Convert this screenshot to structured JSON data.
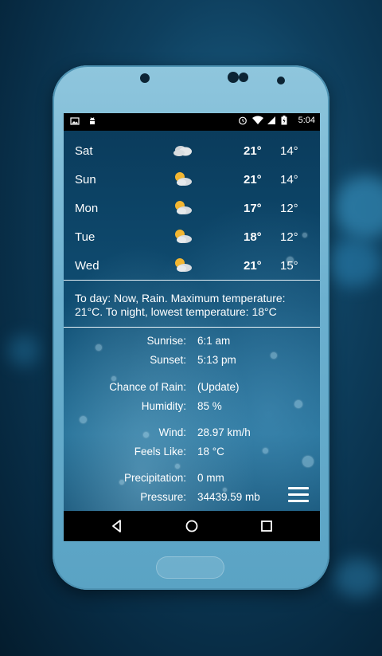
{
  "status_bar": {
    "left_icons": [
      "image-icon",
      "android-debug-icon"
    ],
    "right_icons": [
      "alarm-icon",
      "wifi-icon",
      "signal-icon",
      "battery-icon"
    ],
    "time": "5:04"
  },
  "forecast": [
    {
      "day": "Sat",
      "icon": "cloud-icon",
      "high": "21°",
      "low": "14°"
    },
    {
      "day": "Sun",
      "icon": "partly-sunny-icon",
      "high": "21°",
      "low": "14°"
    },
    {
      "day": "Mon",
      "icon": "partly-sunny-icon",
      "high": "17°",
      "low": "12°"
    },
    {
      "day": "Tue",
      "icon": "partly-sunny-icon",
      "high": "18°",
      "low": "12°"
    },
    {
      "day": "Wed",
      "icon": "partly-sunny-icon",
      "high": "21°",
      "low": "15°"
    }
  ],
  "summary": "To day: Now, Rain. Maximum temperature: 21°C. To night, lowest temperature: 18°C",
  "details": {
    "sunrise": {
      "label": "Sunrise:",
      "value": "6:1 am"
    },
    "sunset": {
      "label": "Sunset:",
      "value": "5:13 pm"
    },
    "chance_of_rain": {
      "label": "Chance of Rain:",
      "value": "(Update)"
    },
    "humidity": {
      "label": "Humidity:",
      "value": "85 %"
    },
    "wind": {
      "label": "Wind:",
      "value": "28.97 km/h"
    },
    "feels_like": {
      "label": "Feels Like:",
      "value": "18 °C"
    },
    "precipitation": {
      "label": "Precipitation:",
      "value": "0 mm"
    },
    "pressure": {
      "label": "Pressure:",
      "value": "34439.59 mb"
    }
  },
  "menu_icon": "hamburger-menu-icon",
  "nav": {
    "back": "back-icon",
    "home": "home-icon",
    "recents": "recents-icon"
  }
}
